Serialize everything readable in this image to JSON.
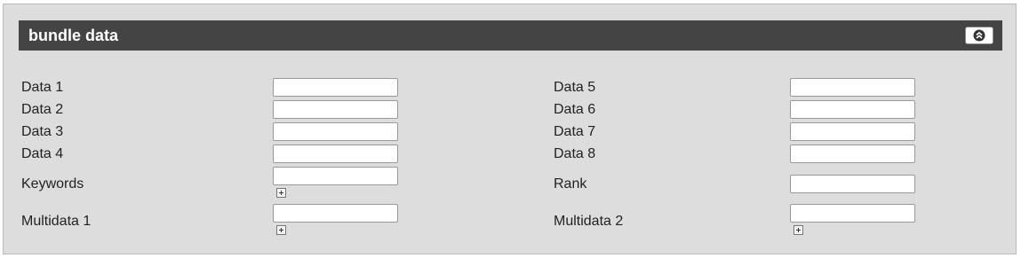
{
  "panel": {
    "title": "bundle data",
    "collapse_icon": "collapse-up-icon"
  },
  "fields": {
    "data1": {
      "label": "Data 1",
      "value": ""
    },
    "data2": {
      "label": "Data 2",
      "value": ""
    },
    "data3": {
      "label": "Data 3",
      "value": ""
    },
    "data4": {
      "label": "Data 4",
      "value": ""
    },
    "keywords": {
      "label": "Keywords",
      "value": ""
    },
    "multidata1": {
      "label": "Multidata 1",
      "value": ""
    },
    "data5": {
      "label": "Data 5",
      "value": ""
    },
    "data6": {
      "label": "Data 6",
      "value": ""
    },
    "data7": {
      "label": "Data 7",
      "value": ""
    },
    "data8": {
      "label": "Data 8",
      "value": ""
    },
    "rank": {
      "label": "Rank",
      "value": ""
    },
    "multidata2": {
      "label": "Multidata 2",
      "value": ""
    }
  },
  "colors": {
    "header_bg": "#444444",
    "panel_bg": "#dddddd",
    "header_text": "#ffffff"
  }
}
